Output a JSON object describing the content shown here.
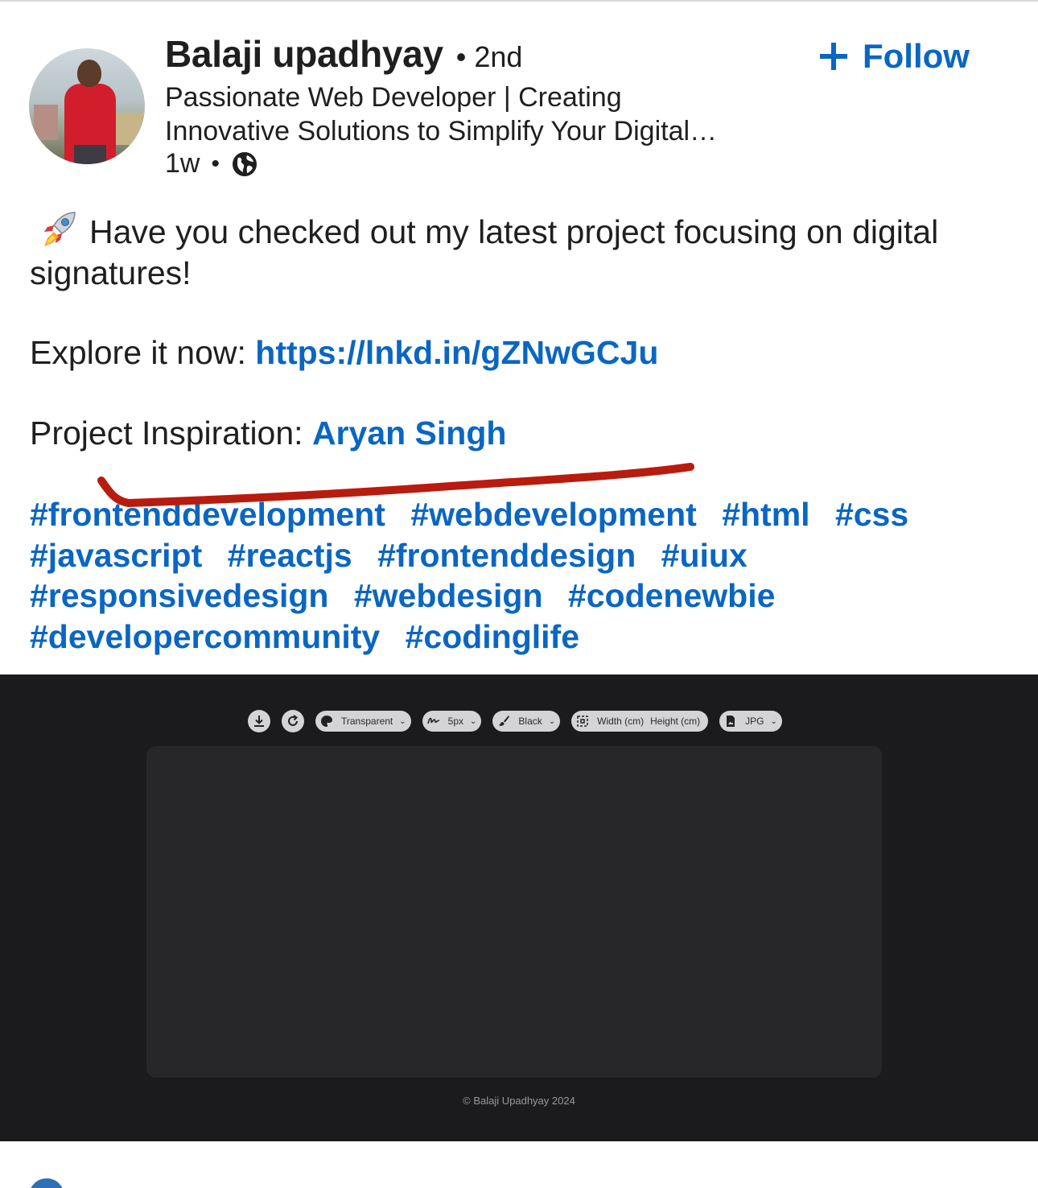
{
  "author": {
    "name": "Balaji upadhyay",
    "degree": "• 2nd",
    "headline_line1": "Passionate Web Developer | Creating",
    "headline_line2": "Innovative Solutions to Simplify Your Digital…",
    "time": "1w",
    "visibility_icon": "globe-icon"
  },
  "follow": {
    "label": "Follow",
    "icon": "plus-icon"
  },
  "post": {
    "line1": "Have you checked out my latest project focusing on digital",
    "line2": "signatures!",
    "explore_prefix": "Explore it now: ",
    "explore_link": "https://lnkd.in/gZNwGCJu",
    "inspiration_prefix": "Project Inspiration: ",
    "inspiration_name": "Aryan Singh",
    "hashtags": [
      "#frontenddevelopment",
      "#webdevelopment",
      "#html",
      "#css",
      "#javascript",
      "#reactjs",
      "#frontenddesign",
      "#uiux",
      "#responsivedesign",
      "#webdesign",
      "#codenewbie",
      "#developercommunity",
      "#codinglife"
    ]
  },
  "image": {
    "toolbar": {
      "background": "Transparent",
      "stroke": "5px",
      "color": "Black",
      "width_label": "Width (cm)",
      "height_label": "Height (cm)",
      "format": "JPG"
    },
    "copyright": "© Balaji Upadhyay 2024"
  },
  "colors": {
    "link": "#0a66c2",
    "annotation": "#b81c0e",
    "panel_bg": "#1b1b1d",
    "canvas_bg": "#272729"
  }
}
